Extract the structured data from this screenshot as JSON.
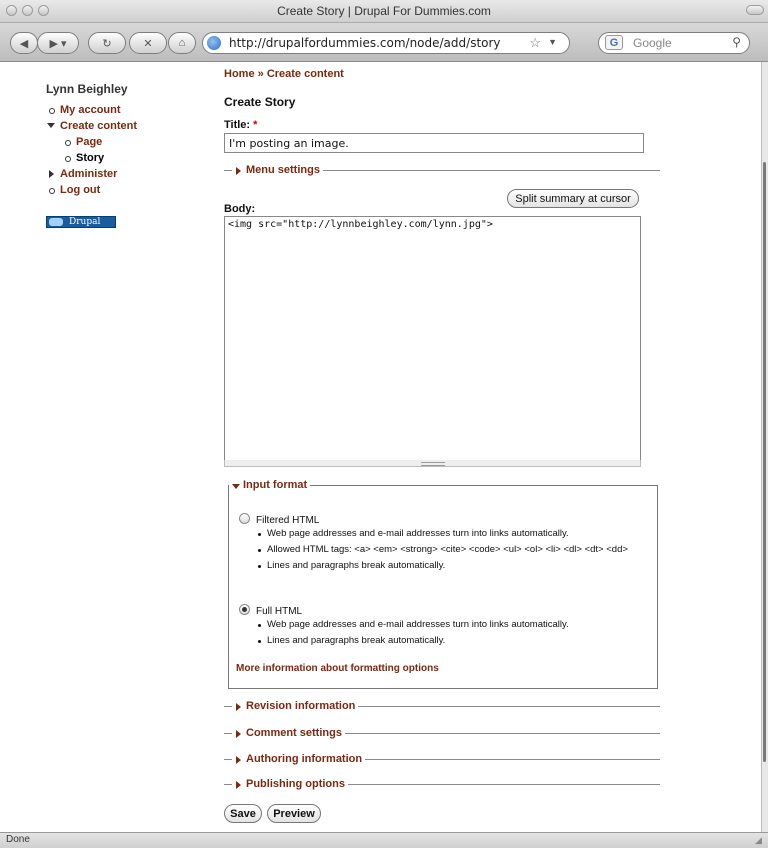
{
  "window": {
    "title": "Create Story | Drupal For Dummies.com"
  },
  "toolbar": {
    "url": "http://drupalfordummies.com/node/add/story",
    "search_placeholder": "Google"
  },
  "sidebar": {
    "user": "Lynn Beighley",
    "items": [
      {
        "label": "My account"
      },
      {
        "label": "Create content"
      },
      {
        "label": "Page"
      },
      {
        "label": "Story"
      },
      {
        "label": "Administer"
      },
      {
        "label": "Log out"
      }
    ],
    "badge": "Drupal"
  },
  "breadcrumb": {
    "home": "Home",
    "sep": "»",
    "current": "Create content"
  },
  "page_title": "Create Story",
  "form": {
    "title_label": "Title:",
    "required_mark": "*",
    "title_value": "I'm posting an image.",
    "menu_settings": "Menu settings",
    "split_button": "Split summary at cursor",
    "body_label": "Body:",
    "body_value": "<img src=\"http://lynnbeighley.com/lynn.jpg\">",
    "input_format": {
      "legend": "Input format",
      "filtered": {
        "label": "Filtered HTML",
        "tips": [
          "Web page addresses and e-mail addresses turn into links automatically.",
          "Allowed HTML tags: <a> <em> <strong> <cite> <code> <ul> <ol> <li> <dl> <dt> <dd>",
          "Lines and paragraphs break automatically."
        ]
      },
      "full": {
        "label": "Full HTML",
        "tips": [
          "Web page addresses and e-mail addresses turn into links automatically.",
          "Lines and paragraphs break automatically."
        ]
      },
      "selected": "Full HTML",
      "more_link": "More information about formatting options"
    },
    "sections": [
      "Revision information",
      "Comment settings",
      "Authoring information",
      "Publishing options"
    ],
    "save": "Save",
    "preview": "Preview"
  },
  "status": "Done"
}
